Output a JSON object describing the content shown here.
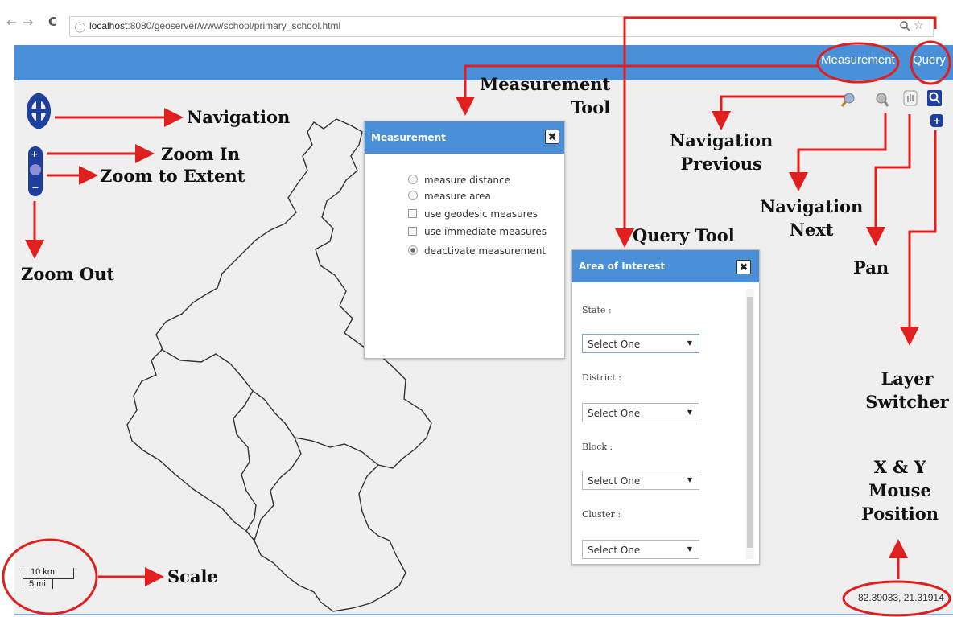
{
  "browser": {
    "back_glyph": "←",
    "forward_glyph": "→",
    "reload_glyph": "C",
    "info_glyph": "ⓘ",
    "url_host": "localhost",
    "url_rest": ":8080/geoserver/www/school/primary_school.html"
  },
  "header": {
    "measurement_label": "Measurement",
    "query_label": "Query",
    "bar_color": "#4a90d9"
  },
  "measurement_dialog": {
    "title": "Measurement",
    "close_glyph": "✖",
    "options": [
      {
        "label": "measure distance",
        "kind": "radio",
        "selected": false
      },
      {
        "label": "measure area",
        "kind": "radio",
        "selected": false
      },
      {
        "label": "use geodesic measures",
        "kind": "checkbox",
        "selected": false
      },
      {
        "label": "use immediate measures",
        "kind": "checkbox",
        "selected": false
      },
      {
        "label": "deactivate measurement",
        "kind": "radio",
        "selected": true
      }
    ]
  },
  "aoi_dialog": {
    "title": "Area of Interest",
    "close_glyph": "✖",
    "fields": [
      {
        "label": "State :",
        "value": "Select One"
      },
      {
        "label": "District :",
        "value": "Select One"
      },
      {
        "label": "Block :",
        "value": "Select One"
      },
      {
        "label": "Cluster :",
        "value": "Select One"
      }
    ]
  },
  "scale": {
    "km": "10 km",
    "mi": "5 mi"
  },
  "mouse_position": "82.39033, 21.31914",
  "annotations": {
    "navigation": "Navigation",
    "zoom_in": "Zoom In",
    "zoom_extent": "Zoom to Extent",
    "zoom_out": "Zoom Out",
    "measurement_tool_1": "Measurement",
    "measurement_tool_2": "Tool",
    "nav_previous_1": "Navigation",
    "nav_previous_2": "Previous",
    "nav_next_1": "Navigation",
    "nav_next_2": "Next",
    "query_tool": "Query Tool",
    "pan": "Pan",
    "layer_switcher_1": "Layer",
    "layer_switcher_2": "Switcher",
    "mouse_pos_1": "X & Y",
    "mouse_pos_2": "Mouse",
    "mouse_pos_3": "Position",
    "scale": "Scale"
  },
  "colors": {
    "annotation_red": "#e01f1f",
    "dialog_header": "#4a90d9",
    "nav_blue": "#1f3f9f"
  },
  "icons": [
    "zoom-previous-icon",
    "zoom-next-icon",
    "pan-hand-icon",
    "query-search-icon",
    "layer-switcher-plus-icon"
  ]
}
